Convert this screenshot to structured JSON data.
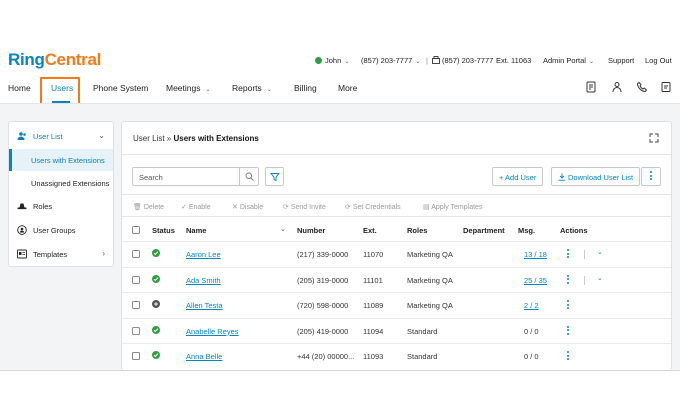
{
  "brand": {
    "ring": "Ring",
    "central": "Central",
    "ring_color": "#0684bd",
    "central_color": "#f27a1b"
  },
  "header": {
    "user": "John",
    "phone_main": "(857) 203-7777",
    "separator": "|",
    "phone_direct": "(857) 203-7777",
    "ext": "Ext. 11063",
    "admin_portal": "Admin Portal",
    "support": "Support",
    "logout": "Log Out"
  },
  "nav": {
    "items": [
      {
        "label": "Home"
      },
      {
        "label": "Users",
        "selected": true
      },
      {
        "label": "Phone System"
      },
      {
        "label": "Meetings",
        "dropdown": true
      },
      {
        "label": "Reports",
        "dropdown": true
      },
      {
        "label": "Billing"
      },
      {
        "label": "More"
      }
    ],
    "icons": [
      "doc-icon",
      "person-icon",
      "phone-icon",
      "note-icon"
    ]
  },
  "sidebar": {
    "items": [
      {
        "label": "User List",
        "icon": "users-icon",
        "expanded": true
      },
      {
        "label": "Users with Extensions",
        "sub": true,
        "active": true
      },
      {
        "label": "Unassigned Extensions",
        "sub": true
      },
      {
        "label": "Roles",
        "icon": "hat-icon"
      },
      {
        "label": "User Groups",
        "icon": "group-icon"
      },
      {
        "label": "Templates",
        "icon": "template-icon",
        "has_children": true
      }
    ]
  },
  "main": {
    "breadcrumb_parent": "User List",
    "breadcrumb_sep": "»",
    "breadcrumb_current": "Users with Extensions",
    "search_placeholder": "Search",
    "add_user": "+ Add User",
    "download": "Download User List",
    "toolbar": [
      "Delete",
      "Enable",
      "Disable",
      "Send Invite",
      "Set Credentials",
      "Apply Templates"
    ],
    "columns": [
      "Status",
      "Name",
      "Number",
      "Ext.",
      "Roles",
      "Department",
      "Msg.",
      "Actions"
    ],
    "rows": [
      {
        "status": "active",
        "name": "Aaron Lee",
        "number": "(217) 339-0000",
        "ext": "11070",
        "roles": "Marketing QA",
        "department": "",
        "msg": "13 / 18",
        "msg_link": true,
        "extra_actions": true
      },
      {
        "status": "active",
        "name": "Ada Smith",
        "number": "(205) 319-0000",
        "ext": "11101",
        "roles": "Marketing QA",
        "department": "",
        "msg": "25 / 35",
        "msg_link": true,
        "extra_actions": true
      },
      {
        "status": "other",
        "name": "Allen Testa",
        "number": "(720) 598-0000",
        "ext": "11089",
        "roles": "Marketing QA",
        "department": "",
        "msg": "2 / 2",
        "msg_link": true,
        "extra_actions": false
      },
      {
        "status": "active",
        "name": "Anabelle Reyes",
        "number": "(205) 419-0000",
        "ext": "11094",
        "roles": "Standard",
        "department": "",
        "msg": "0 / 0",
        "msg_link": false,
        "extra_actions": false
      },
      {
        "status": "active",
        "name": "Anna Belle",
        "number": "+44 (20) 00000...",
        "ext": "11093",
        "roles": "Standard",
        "department": "",
        "msg": "0 / 0",
        "msg_link": false,
        "extra_actions": false
      }
    ]
  }
}
